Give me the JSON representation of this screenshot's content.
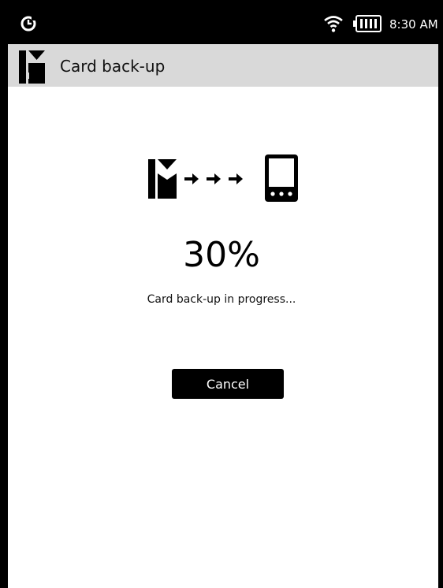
{
  "status_bar": {
    "time": "8:30 AM",
    "icons": [
      "sync-icon",
      "wifi-icon",
      "battery-icon"
    ]
  },
  "app_bar": {
    "title": "Card back-up",
    "logo_icon": "app-logo-icon"
  },
  "main": {
    "graphic_icons": [
      "card-logo-icon",
      "arrow-right-icon",
      "arrow-right-icon",
      "arrow-right-icon",
      "device-icon"
    ],
    "progress_fraction": 0.3,
    "percent_text": "30%",
    "status_text": "Card back-up in progress...",
    "cancel_label": "Cancel"
  },
  "colors": {
    "status_bar_bg": "#000000",
    "app_bar_bg": "#d9d9d9",
    "button_bg": "#000000",
    "button_text": "#ffffff"
  }
}
